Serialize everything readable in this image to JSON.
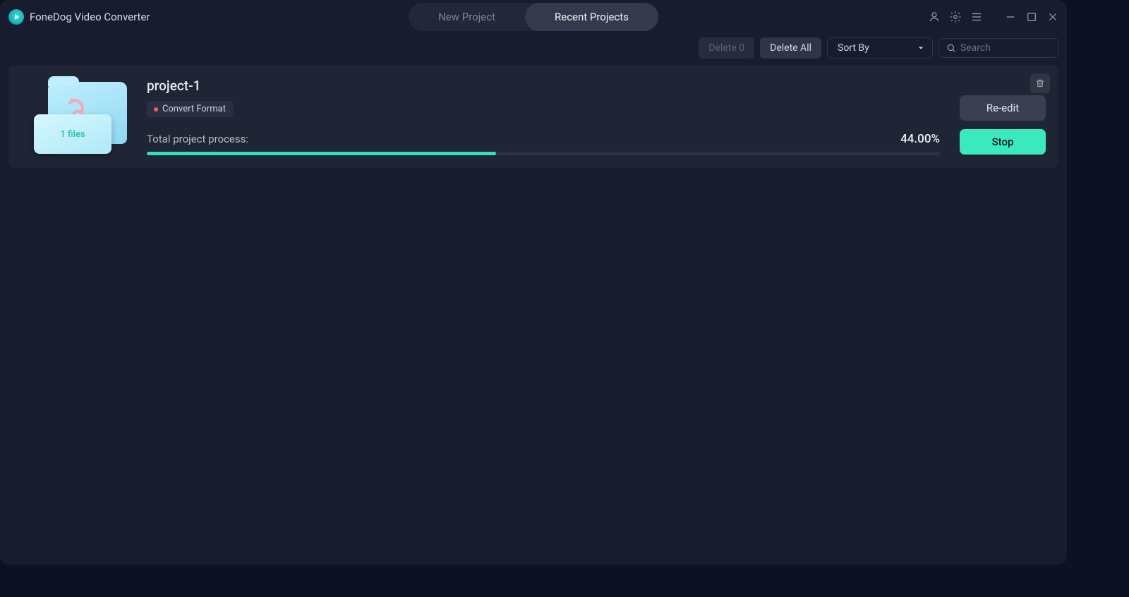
{
  "app": {
    "title": "FoneDog Video Converter"
  },
  "tabs": {
    "new_project": "New Project",
    "recent_projects": "Recent Projects"
  },
  "toolbar": {
    "delete_count_label": "Delete 0",
    "delete_all_label": "Delete All",
    "sort_label": "Sort By",
    "search_placeholder": "Search"
  },
  "project": {
    "name": "project-1",
    "tag_label": "Convert Format",
    "files_label": "1 files",
    "progress_label": "Total project process:",
    "progress_percent": "44.00%",
    "progress_value": 44.0,
    "reedit_label": "Re-edit",
    "stop_label": "Stop"
  }
}
